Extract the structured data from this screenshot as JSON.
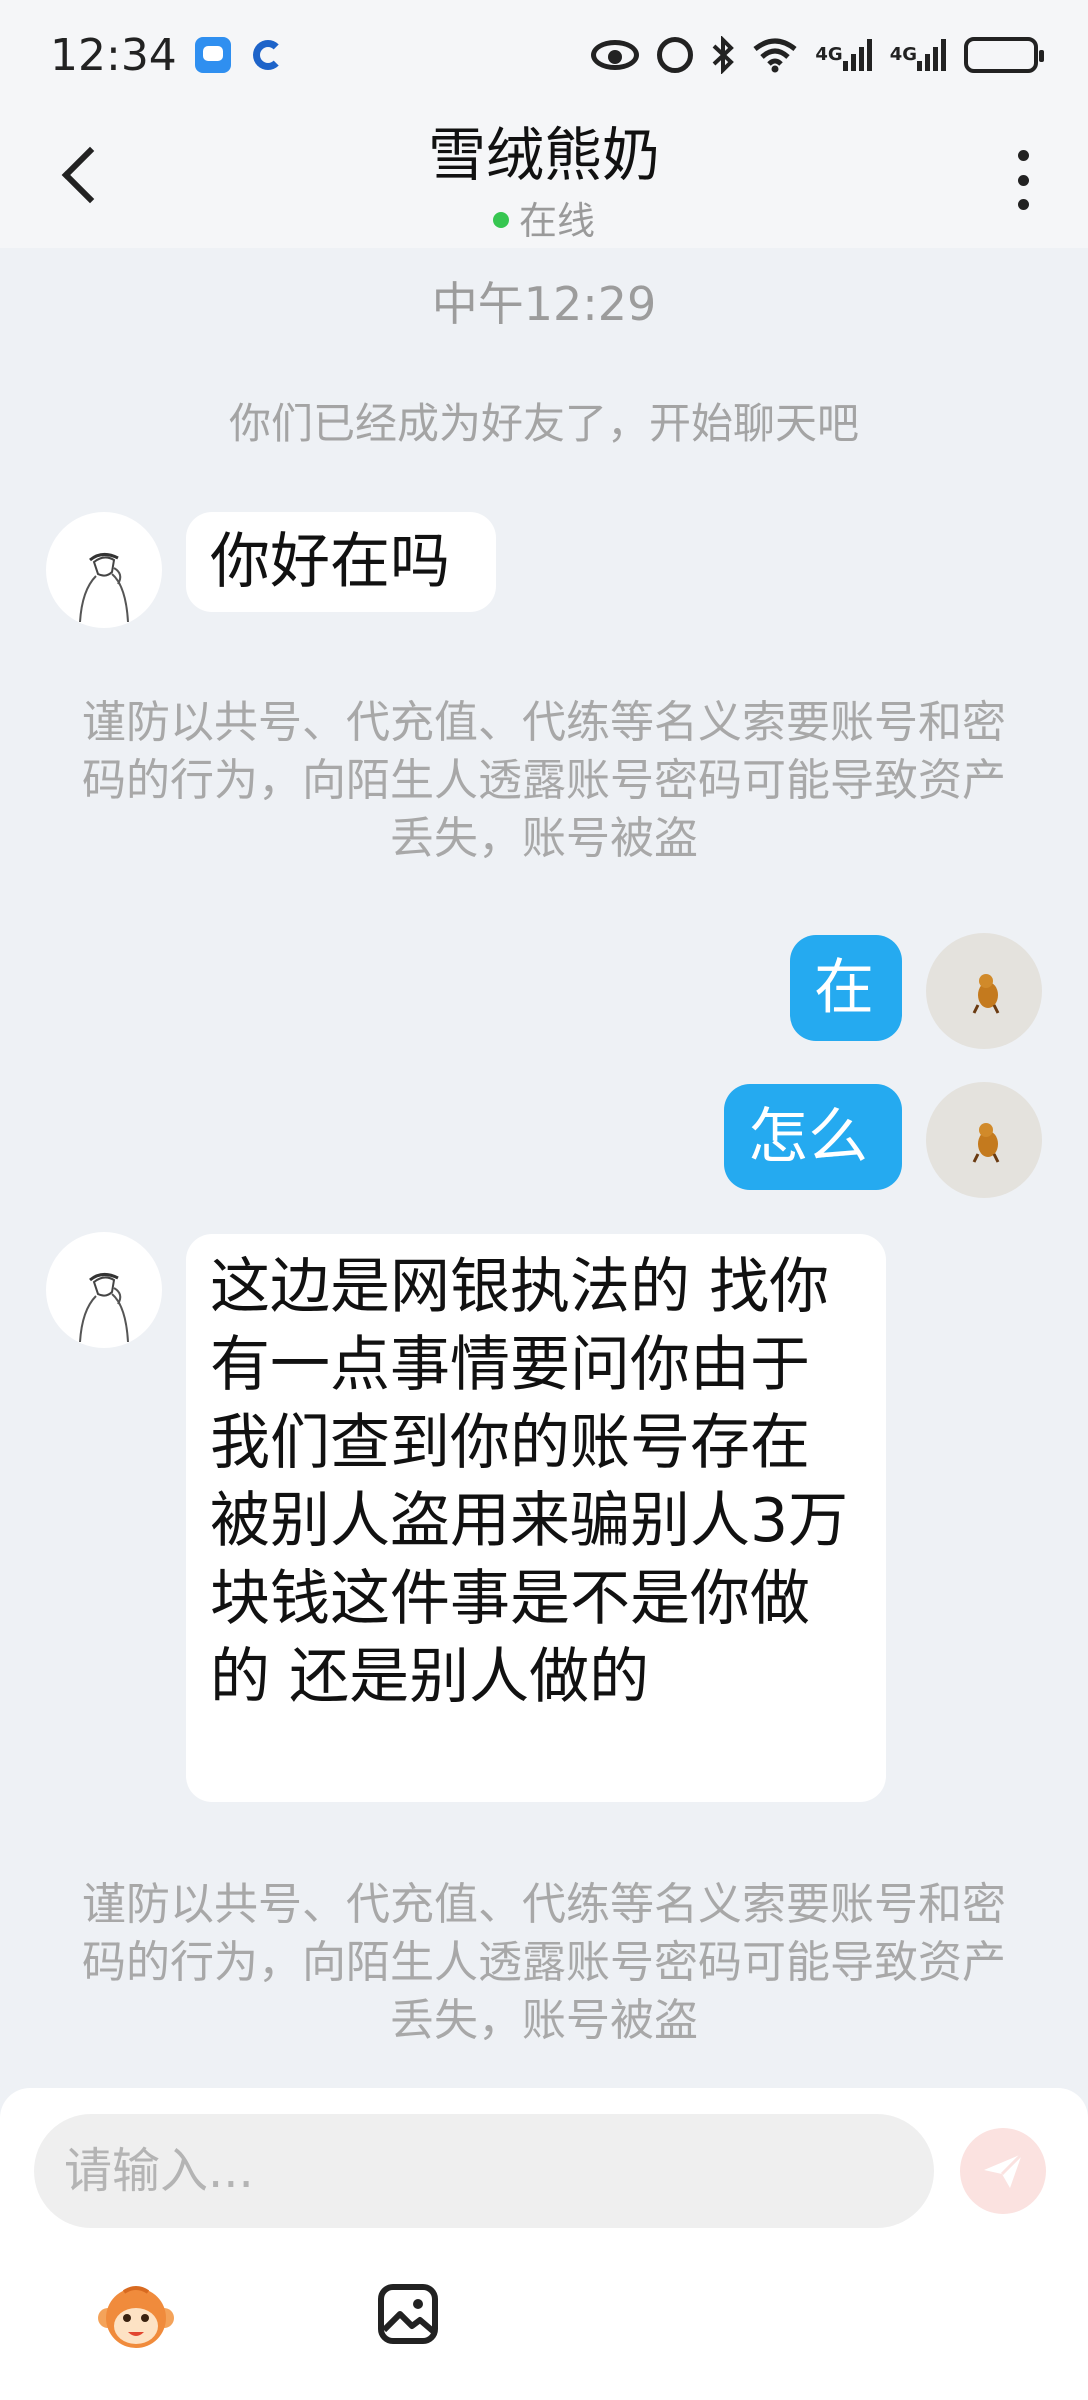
{
  "status_bar": {
    "time": "12:34",
    "network_1": "4G",
    "network_2": "4G"
  },
  "header": {
    "title": "雪绒熊奶",
    "status": "在线",
    "status_color": "#37c651"
  },
  "chat": {
    "timestamp": "中午12:29",
    "system_notice": "你们已经成为好友了，开始聊天吧",
    "messages": [
      {
        "direction": "in",
        "text": "你好在吗"
      },
      {
        "direction": "warning",
        "text": "谨防以共号、代充值、代练等名义索要账号和密码的行为，向陌生人透露账号密码可能导致资产丢失，账号被盗"
      },
      {
        "direction": "out",
        "text": "在"
      },
      {
        "direction": "out",
        "text": "怎么"
      },
      {
        "direction": "in",
        "text": "这边是网银执法的 找你有一点事情要问你由于我们查到你的账号存在被别人盗用来骗别人3万块钱这件事是不是你做的 还是别人做的"
      },
      {
        "direction": "warning",
        "text": "谨防以共号、代充值、代练等名义索要账号和密码的行为，向陌生人透露账号密码可能导致资产丢失，账号被盗"
      }
    ]
  },
  "composer": {
    "placeholder": "请输入..."
  },
  "colors": {
    "outgoing_bubble": "#25aaf0",
    "incoming_bubble": "#ffffff",
    "background": "#eef1f5"
  }
}
